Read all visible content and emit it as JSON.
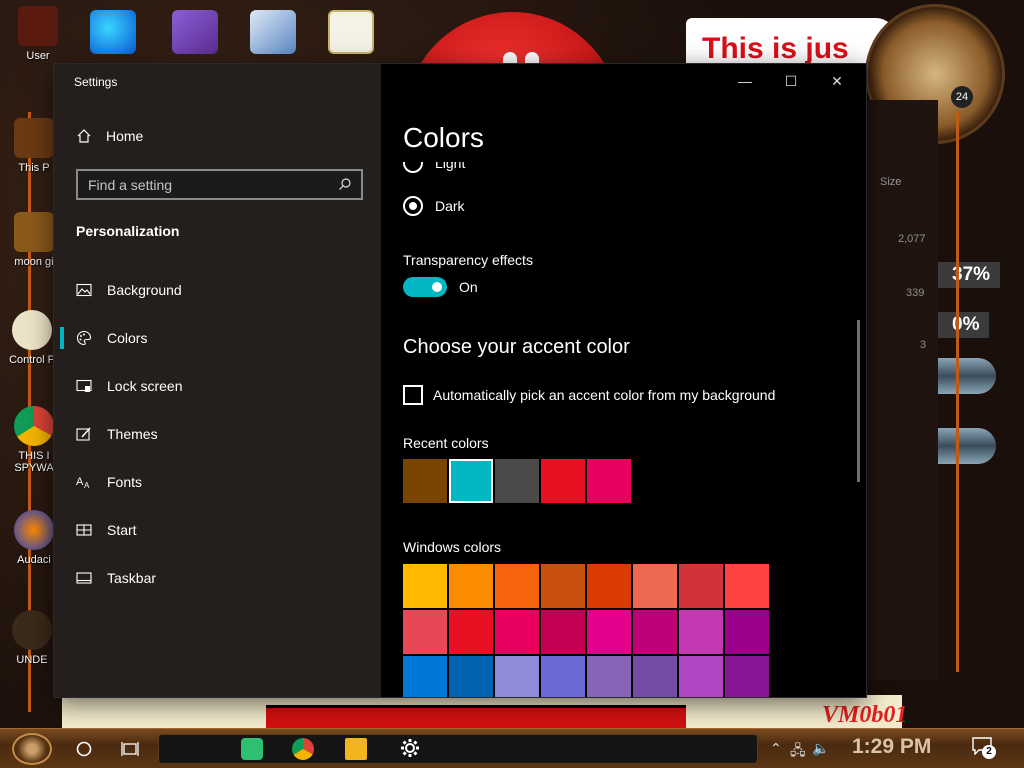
{
  "desktop": {
    "icons": [
      {
        "label": "User"
      },
      {
        "label": "This P"
      },
      {
        "label": "moon gi"
      },
      {
        "label": "Control P"
      },
      {
        "label": "THIS I\nSPYWA"
      },
      {
        "label": "Audaci"
      },
      {
        "label": "UNDE"
      }
    ],
    "top_icons": [
      "edge-icon",
      "visual-studio-icon",
      "virtualbox-icon",
      "hxd-icon"
    ],
    "banner_text": "This is jus",
    "clock_badge": "24",
    "gadget": {
      "size_label": "Size",
      "values": [
        "2,077",
        "339",
        "3"
      ],
      "percent_1": "37%",
      "percent_2": "0%"
    },
    "watermark": "VM0b01"
  },
  "window": {
    "title": "Settings",
    "controls": {
      "minimize": "—",
      "maximize": "☐",
      "close": "✕"
    },
    "sidebar": {
      "home_label": "Home",
      "search_placeholder": "Find a setting",
      "group_title": "Personalization",
      "items": [
        {
          "label": "Background",
          "icon": "picture-icon"
        },
        {
          "label": "Colors",
          "icon": "palette-icon",
          "active": true
        },
        {
          "label": "Lock screen",
          "icon": "lock-screen-icon"
        },
        {
          "label": "Themes",
          "icon": "themes-icon"
        },
        {
          "label": "Fonts",
          "icon": "fonts-icon"
        },
        {
          "label": "Start",
          "icon": "start-icon"
        },
        {
          "label": "Taskbar",
          "icon": "taskbar-icon"
        }
      ]
    },
    "content": {
      "page_title": "Colors",
      "mode_options": [
        {
          "label": "Light",
          "selected": false
        },
        {
          "label": "Dark",
          "selected": true
        }
      ],
      "transparency_label": "Transparency effects",
      "transparency_state": "On",
      "accent_title": "Choose your accent color",
      "auto_accent_label": "Automatically pick an accent color from my background",
      "recent_colors_label": "Recent colors",
      "recent_colors": [
        "#7a4500",
        "#00b7c3",
        "#4c4a48",
        "#e81123",
        "#ea005e"
      ],
      "selected_recent": "#00b7c3",
      "windows_colors_label": "Windows colors",
      "windows_colors": [
        "#ffb900",
        "#ff8c00",
        "#f7630c",
        "#ca5010",
        "#da3b01",
        "#ef6950",
        "#d13438",
        "#ff4343",
        "#e74856",
        "#e81123",
        "#ea005e",
        "#c30052",
        "#e3008c",
        "#bf0077",
        "#c239b3",
        "#9a0089",
        "#0078d7",
        "#0063b1",
        "#8e8cd8",
        "#6b69d6",
        "#8764b8",
        "#744da9",
        "#b146c2",
        "#881798"
      ]
    }
  },
  "taskbar": {
    "time": "1:29 PM",
    "notification_count": "2",
    "apps": [
      "notes-icon",
      "chrome-icon",
      "file-explorer-icon",
      "settings-icon"
    ]
  }
}
